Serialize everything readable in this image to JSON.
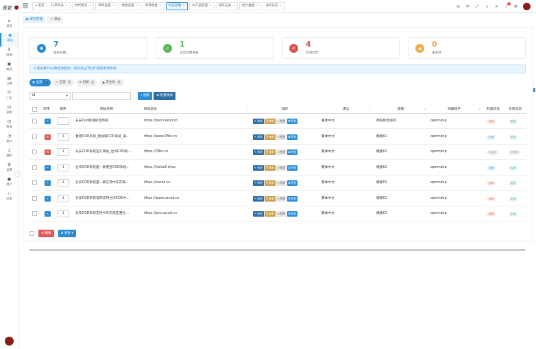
{
  "colors": {
    "primary": "#2b8cd6",
    "danger": "#e05a5a",
    "success": "#27ae60",
    "warning": "#f39c12"
  },
  "sidebar": {
    "items": [
      {
        "icon": "home-icon",
        "label": "首页"
      },
      {
        "icon": "globe-icon",
        "label": "建站"
      },
      {
        "icon": "cart-icon",
        "label": "商城"
      },
      {
        "icon": "box-icon",
        "label": "商品"
      },
      {
        "icon": "document-icon",
        "label": "订单"
      },
      {
        "icon": "ad-icon",
        "label": "广告"
      },
      {
        "icon": "truck-icon",
        "label": "采购"
      },
      {
        "icon": "delivery-icon",
        "label": "物流"
      },
      {
        "icon": "pie-chart-icon",
        "label": "统计"
      },
      {
        "icon": "bell-icon",
        "label": "通知"
      },
      {
        "icon": "gear-icon",
        "label": "设置"
      },
      {
        "icon": "user-icon",
        "label": "用户"
      },
      {
        "icon": "code-icon",
        "label": "开发"
      }
    ]
  },
  "topbar": {
    "tabs": [
      {
        "label": "首页"
      },
      {
        "label": "订单列表"
      },
      {
        "label": "供代物流"
      },
      {
        "label": "项目设置"
      },
      {
        "label": "弹窗设置"
      },
      {
        "label": "项目佣金"
      },
      {
        "label": "域名管理",
        "active": true
      },
      {
        "label": "AI产品管理"
      },
      {
        "label": "操作记录"
      },
      {
        "label": "统计截图"
      },
      {
        "label": "访问日志"
      }
    ],
    "notification_count": "1"
  },
  "subhead": {
    "current_tab": "域名管理",
    "add_label": "添加"
  },
  "stats": [
    {
      "value": "7",
      "label": "域名总数",
      "color": "#2b8cd6",
      "icon": "globe-icon"
    },
    {
      "value": "1",
      "label": "正常可用域名",
      "color": "#5cb85c",
      "icon": "check-icon"
    },
    {
      "value": "4",
      "label": "台湾封禁",
      "color": "#d9534f",
      "icon": "ban-icon"
    },
    {
      "value": "0",
      "label": "未生效",
      "color": "#f0ad4e",
      "icon": "warning-icon"
    }
  ],
  "alert": {
    "text": "域名每20分钟自动检测，也可点击\"检测\"按钮手动检测"
  },
  "filters": [
    {
      "label": "全部",
      "count": "7",
      "active": true
    },
    {
      "label": "正常",
      "count": "1"
    },
    {
      "label": "封禁",
      "count": "4"
    },
    {
      "label": "未生效",
      "count": "0"
    }
  ],
  "search": {
    "field": "id",
    "search_label": "搜索",
    "batch_add_label": "批量添加"
  },
  "table": {
    "headers": {
      "enabled": "可用",
      "sort": "排序",
      "name": "网站名称",
      "url": "网站地址",
      "ops": "操作",
      "lang": "语言",
      "template": "模版",
      "pixel": "扫描账手",
      "block_status": "封禁状态",
      "live_status": "生效状态"
    },
    "op_labels": {
      "edit": "修改",
      "copy": "复制",
      "test": "检测",
      "preview": "预览"
    },
    "rows": [
      {
        "enabled": true,
        "sort": "",
        "name": "长安Cod商城综合商城",
        "url": "https://test.cacod.cn",
        "lang": "繁体中文",
        "template": "商城综合站01",
        "pixel": "qwnmdxp",
        "block": "台湾",
        "block_type": "red",
        "live": "生效",
        "live_type": "green"
      },
      {
        "enabled": false,
        "sort": "1",
        "name": "香港COD系统_新加坡COD系统_泰…",
        "url": "https://www.78kt.cn",
        "lang": "繁体中文",
        "template": "模版01",
        "pixel": "qwnmdxp",
        "block": "正常",
        "block_type": "blue",
        "live": "生效",
        "live_type": "green"
      },
      {
        "enabled": false,
        "sort": "1",
        "name": "长安COD系统官方网站_台湾COD系…",
        "url": "https://78kt.cn",
        "lang": "繁体中文",
        "template": "模版02",
        "pixel": "qwnmdxp",
        "block": "未检测",
        "block_type": "grey",
        "live": "未检测",
        "live_type": "grey"
      },
      {
        "enabled": true,
        "sort": "1",
        "name": "台湾COD系统是一款便宜COD系统…",
        "url": "https://hotsell.shop",
        "lang": "繁体中文",
        "template": "模版02",
        "pixel": "qwnmdxp",
        "block": "正常",
        "block_type": "blue",
        "live": "生效",
        "live_type": "green"
      },
      {
        "enabled": true,
        "sort": "1",
        "name": "长安COD系统是一款支持中东东南…",
        "url": "https://cacod.cn",
        "lang": "繁体中文",
        "template": "模版01",
        "pixel": "qwnmdxp",
        "block": "台湾",
        "block_type": "red",
        "live": "生效",
        "live_type": "green"
      },
      {
        "enabled": true,
        "sort": "1",
        "name": "长安COD系统官网支持台湾COD中…",
        "url": "https://www.cacod.cn",
        "lang": "繁体中文",
        "template": "模版01",
        "pixel": "qwnmdxp",
        "block": "台湾",
        "block_type": "red",
        "live": "生效",
        "live_type": "green"
      },
      {
        "enabled": true,
        "sort": "1",
        "name": "长安COD系统支持中东东南亚港台…",
        "url": "https://pro.cacod.cn",
        "lang": "繁体中文",
        "template": "模版01",
        "pixel": "qwnmdxp",
        "block": "台湾",
        "block_type": "red",
        "live": "生效",
        "live_type": "green"
      }
    ]
  },
  "bottom": {
    "delete_label": "删除",
    "more_label": "更多"
  }
}
